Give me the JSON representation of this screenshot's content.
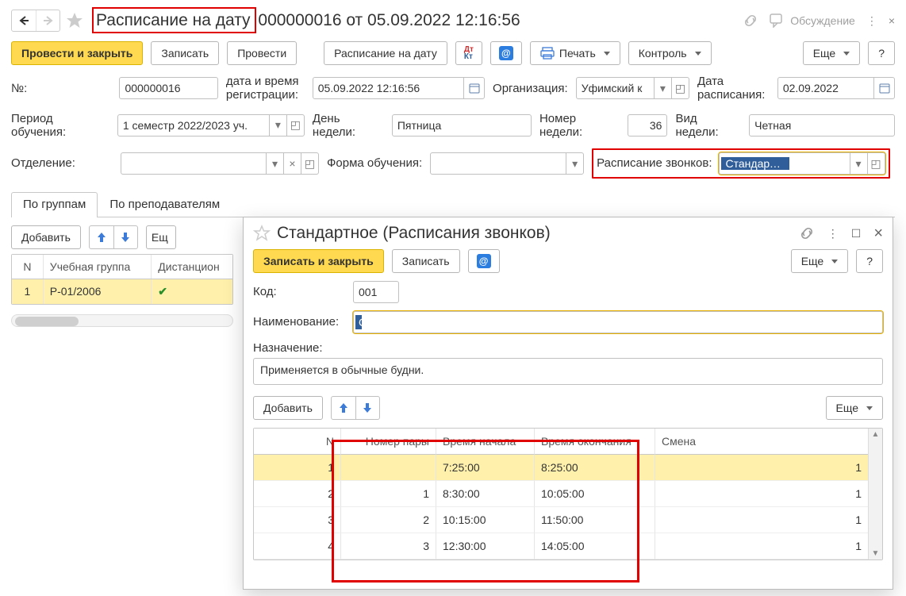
{
  "titlebar": {
    "title_prefix": "Расписание на дату",
    "title_rest": " 000000016 от 05.09.2022 12:16:56",
    "discussion": "Обсуждение"
  },
  "toolbar": {
    "post_close": "Провести и закрыть",
    "write": "Записать",
    "post": "Провести",
    "sched_date": "Расписание на дату",
    "print": "Печать",
    "control": "Контроль",
    "more": "Еще",
    "help": "?"
  },
  "form": {
    "num_label": "№:",
    "num": "000000016",
    "regdate_label": "дата и время регистрации:",
    "regdate": "05.09.2022 12:16:56",
    "org_label": "Организация:",
    "org": "Уфимский к",
    "sched_date_label": "Дата расписания:",
    "sched_date": "02.09.2022",
    "period_label": "Период обучения:",
    "period": "1 семестр 2022/2023 уч.",
    "day_label": "День недели:",
    "day": "Пятница",
    "weeknum_label": "Номер недели:",
    "weeknum": "36",
    "weektype_label": "Вид недели:",
    "weektype": "Четная",
    "dept_label": "Отделение:",
    "dept": "",
    "eduform_label": "Форма обучения:",
    "eduform": "",
    "bells_label": "Расписание звонков:",
    "bells": "Стандартное"
  },
  "tabs": {
    "groups": "По группам",
    "teachers": "По преподавателям"
  },
  "sub": {
    "add": "Добавить",
    "more": "Ещ"
  },
  "groups_table": {
    "headers": {
      "n": "N",
      "group": "Учебная группа",
      "dist": "Дистанцион"
    },
    "rows": [
      {
        "n": "1",
        "group": "Р-01/2006",
        "dist": true
      }
    ]
  },
  "modal": {
    "title": "Стандартное (Расписания звонков)",
    "save_close": "Записать и закрыть",
    "write": "Записать",
    "more": "Еще",
    "help": "?",
    "code_label": "Код:",
    "code": "001",
    "name_label": "Наименование:",
    "name": "Стандартное",
    "purpose_label": "Назначение:",
    "purpose": "Применяется в обычные будни.",
    "add": "Добавить",
    "table": {
      "headers": {
        "n": "N",
        "pair": "Номер пары",
        "start": "Время начала",
        "end": "Время окончания",
        "shift": "Смена"
      },
      "rows": [
        {
          "n": "1",
          "pair": "",
          "start": "7:25:00",
          "end": "8:25:00",
          "shift": "1"
        },
        {
          "n": "2",
          "pair": "1",
          "start": "8:30:00",
          "end": "10:05:00",
          "shift": "1"
        },
        {
          "n": "3",
          "pair": "2",
          "start": "10:15:00",
          "end": "11:50:00",
          "shift": "1"
        },
        {
          "n": "4",
          "pair": "3",
          "start": "12:30:00",
          "end": "14:05:00",
          "shift": "1"
        }
      ]
    }
  },
  "icons": {
    "cal": "📅",
    "open": "▢",
    "down": "▾",
    "x": "×",
    "up": "▲",
    "dn": "▼",
    "link": "link",
    "chat": "chat",
    "dots": "⋮",
    "close": "×",
    "max": "☐",
    "star": "★",
    "print": "print"
  }
}
